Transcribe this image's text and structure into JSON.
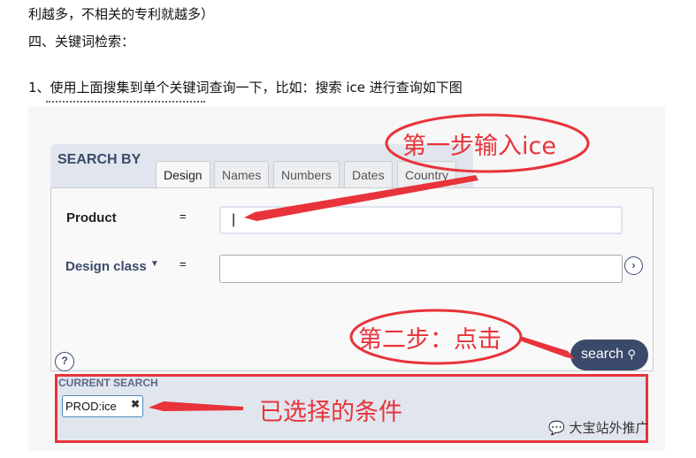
{
  "doc": {
    "line1": "利越多，不相关的专利就越多）",
    "line2": "四、关键词检索：",
    "line3": "1、使用上面搜集到单个关键词查询一下，比如：搜索 ice 进行查询如下图"
  },
  "search": {
    "title": "SEARCH BY",
    "tabs": [
      "Design",
      "Names",
      "Numbers",
      "Dates",
      "Country"
    ],
    "active_tab": "Design",
    "product_label": "Product",
    "eq": "=",
    "product_value": "|",
    "design_class_label": "Design class",
    "design_class_value": "",
    "help": "?",
    "button": "search"
  },
  "current": {
    "title": "CURRENT SEARCH",
    "chip": "PROD:ice"
  },
  "annotations": {
    "step1": "第一步输入ice",
    "step2": "第二步：点击",
    "selected": "已选择的条件",
    "color": "#e8333a"
  },
  "watermark": "大宝站外推广",
  "colors": {
    "button": "#3b4a6b",
    "panel_header": "#e1e6ee"
  }
}
